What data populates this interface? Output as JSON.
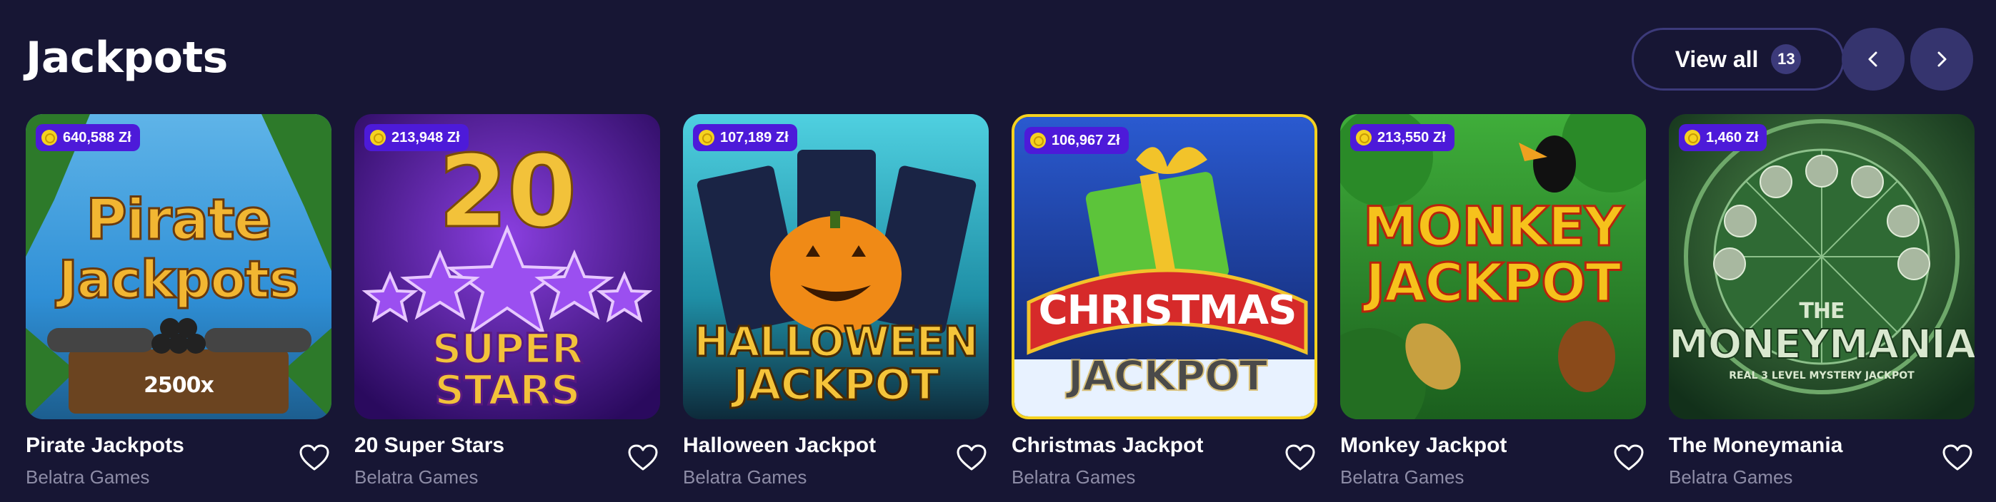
{
  "section": {
    "title": "Jackpots",
    "view_all_label": "View all",
    "view_all_count": "13",
    "prev_icon": "chevron-left-icon",
    "next_icon": "chevron-right-icon"
  },
  "games": [
    {
      "name": "Pirate Jackpots",
      "provider": "Belatra Games",
      "jackpot": "640,588 Zł",
      "art_line1": "Pirate",
      "art_line2": "Jackpots",
      "art_extra": "2500x",
      "colors": {
        "bg": "#2f8fd6",
        "accent": "#f2b632"
      }
    },
    {
      "name": "20 Super Stars",
      "provider": "Belatra Games",
      "jackpot": "213,948 Zł",
      "art_line1": "20",
      "art_line2": "SUPER STARS",
      "colors": {
        "bg": "#4b1b8f",
        "accent": "#f2c23a"
      }
    },
    {
      "name": "Halloween Jackpot",
      "provider": "Belatra Games",
      "jackpot": "107,189 Zł",
      "art_line1": "HALLOWEEN",
      "art_line2": "JACKPOT",
      "colors": {
        "bg": "#1f8fa6",
        "accent": "#f0a020"
      }
    },
    {
      "name": "Christmas Jackpot",
      "provider": "Belatra Games",
      "jackpot": "106,967 Zł",
      "art_line1": "CHRISTMAS",
      "art_line2": "JACKPOT",
      "colors": {
        "bg": "#1d3f9e",
        "accent": "#d62a2a"
      }
    },
    {
      "name": "Monkey Jackpot",
      "provider": "Belatra Games",
      "jackpot": "213,550 Zł",
      "art_line1": "MONKEY",
      "art_line2": "JACKPOT",
      "colors": {
        "bg": "#2c8c2c",
        "accent": "#f6c21c"
      }
    },
    {
      "name": "The Moneymania",
      "provider": "Belatra Games",
      "jackpot": "1,460 Zł",
      "art_line1": "THE",
      "art_line2": "MONEYMANIA",
      "art_extra": "REAL 3 LEVEL MYSTERY JACKPOT",
      "colors": {
        "bg": "#1e4a24",
        "accent": "#d9e8cf"
      }
    }
  ],
  "favorite_icon": "heart-outline-icon",
  "coin_icon": "coin-icon"
}
